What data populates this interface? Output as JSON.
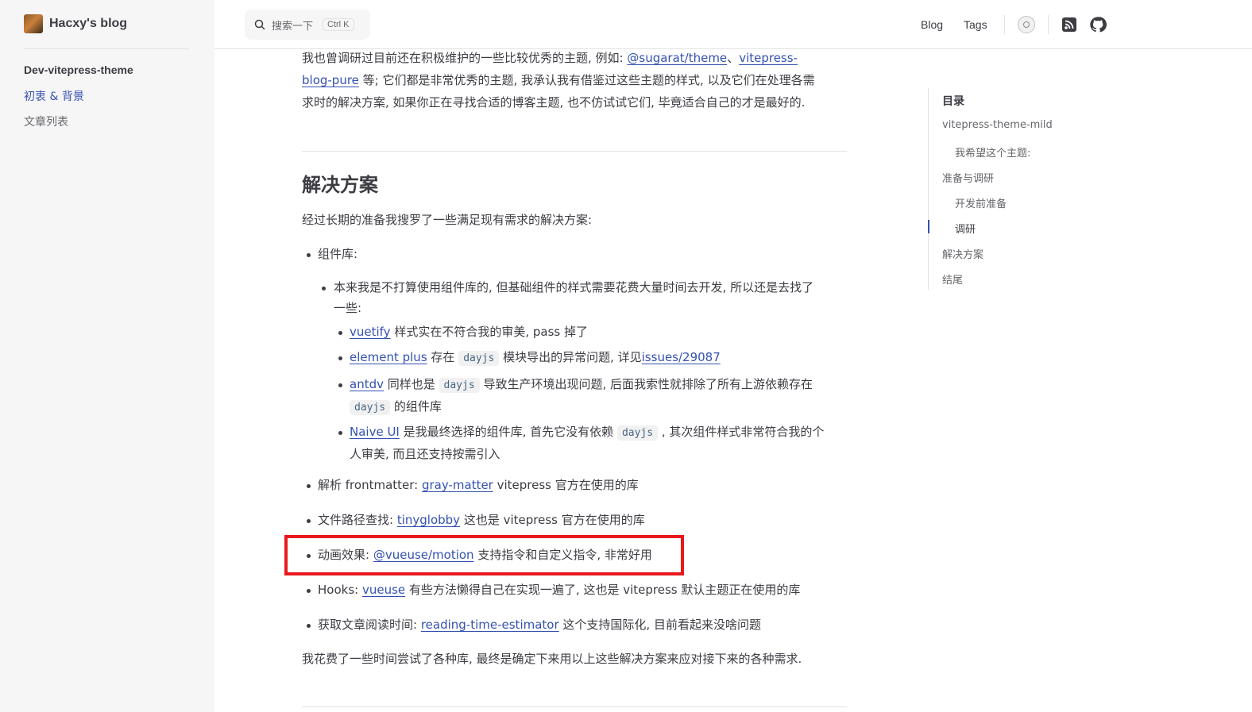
{
  "site": {
    "title": "Hacxy's blog"
  },
  "sidebar": {
    "group_title": "Dev-vitepress-theme",
    "items": [
      {
        "label": "初衷 & 背景",
        "active": true
      },
      {
        "label": "文章列表",
        "active": false
      }
    ]
  },
  "header": {
    "search_placeholder": "搜索一下",
    "search_shortcut": "Ctrl K",
    "nav": [
      {
        "label": "Blog"
      },
      {
        "label": "Tags"
      }
    ],
    "icons": [
      "theme-toggle-icon",
      "rss-icon",
      "github-icon"
    ]
  },
  "article": {
    "intro": {
      "t1": "我也曾调研过目前还在积极维护的一些比较优秀的主题, 例如: ",
      "link1": "@sugarat/theme",
      "sep": "、",
      "link2a": "vitepress-",
      "link2b": "blog-pure",
      "t2": " 等; 它们都是非常优秀的主题, 我承认我有借鉴过这些主题的样式, 以及它们在处理各需",
      "t3": "求时的解决方案, 如果你正在寻找合适的博客主题, 也不仿试试它们, 毕竟适合自己的才是最好的."
    },
    "heading": "解决方案",
    "lead": "经过长期的准备我搜罗了一些满足现有需求的解决方案:",
    "component_lib": {
      "label": "组件库:",
      "reason_line1": "本来我是不打算使用组件库的, 但基础组件的样式需要花费大量时间去开发, 所以还是去找了",
      "reason_line2": "一些:",
      "vuetify": {
        "link": "vuetify",
        "text": " 样式实在不符合我的审美, pass 掉了"
      },
      "element": {
        "link": "element plus",
        "t1": " 存在 ",
        "code": "dayjs",
        "t2": " 模块导出的异常问题, 详见",
        "issue": "issues/29087"
      },
      "antdv": {
        "link": "antdv",
        "t1": " 同样也是 ",
        "code": "dayjs",
        "t2": " 导致生产环境出现问题, 后面我索性就排除了所有上游依赖存在",
        "code2": "dayjs",
        "t3": " 的组件库"
      },
      "naive": {
        "link": "Naive UI",
        "t1": " 是我最终选择的组件库, 首先它没有依赖 ",
        "code": "dayjs",
        "t2": " , 其次组件样式非常符合我的个",
        "t3": "人审美, 而且还支持按需引入"
      }
    },
    "frontmatter": {
      "label": "解析 frontmatter: ",
      "link": "gray-matter",
      "text": " vitepress 官方在使用的库"
    },
    "glob": {
      "label": "文件路径查找: ",
      "link": "tinyglobby",
      "text": " 这也是 vitepress 官方在使用的库"
    },
    "motion": {
      "label": "动画效果: ",
      "link": "@vueuse/motion",
      "text": " 支持指令和自定义指令, 非常好用"
    },
    "hooks": {
      "label": "Hooks: ",
      "link": "vueuse",
      "text": " 有些方法懒得自己在实现一遍了, 这也是 vitepress 默认主题正在使用的库"
    },
    "reading": {
      "label": "获取文章阅读时间: ",
      "link": "reading-time-estimator",
      "text": " 这个支持国际化, 目前看起来没啥问题"
    },
    "conclusion": "我花费了一些时间尝试了各种库, 最终是确定下来用以上这些解决方案来应对接下来的各种需求."
  },
  "toc": {
    "title": "目录",
    "items": [
      {
        "label": "vitepress-theme-mild",
        "level": 1
      },
      {
        "label": "我希望这个主题:",
        "level": 2
      },
      {
        "label": "准备与调研",
        "level": 1
      },
      {
        "label": "开发前准备",
        "level": 2
      },
      {
        "label": "调研",
        "level": 2,
        "active": true
      },
      {
        "label": "解决方案",
        "level": 1
      },
      {
        "label": "结尾",
        "level": 1
      }
    ]
  },
  "colors": {
    "accent": "#3451b2",
    "highlight_border": "#e8191c",
    "sidebar_bg": "#f6f6f7"
  }
}
